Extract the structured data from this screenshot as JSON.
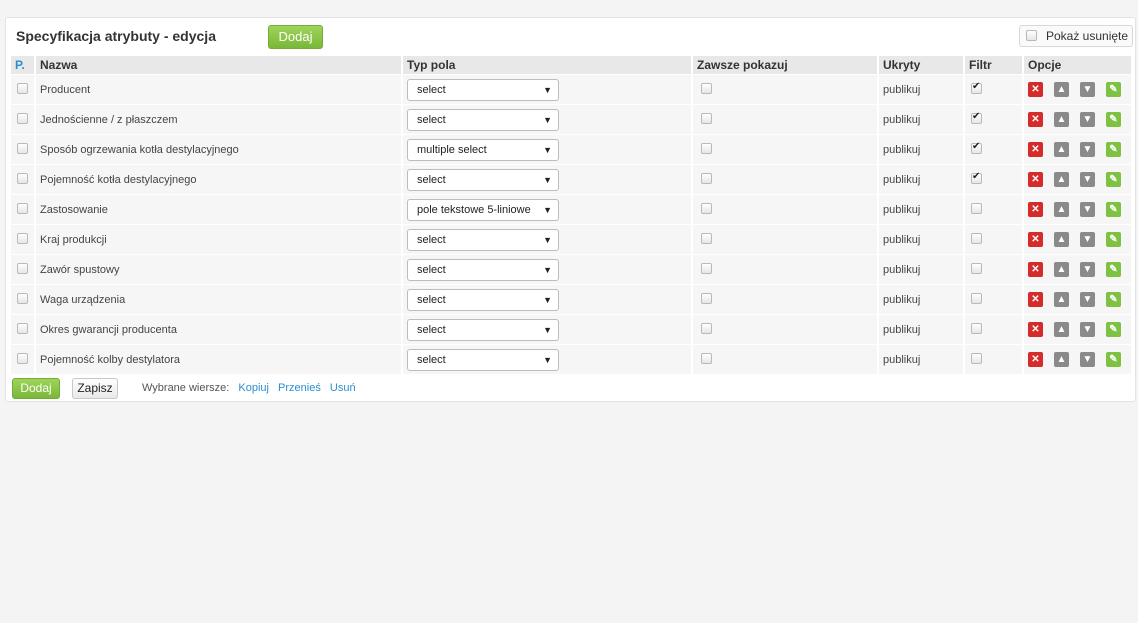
{
  "panel": {
    "title": "Specyfikacja atrybuty - edycja",
    "add_label": "Dodaj",
    "show_deleted_label": "Pokaż usunięte"
  },
  "table": {
    "headers": {
      "p": "P.",
      "name": "Nazwa",
      "type": "Typ pola",
      "always": "Zawsze pokazuj",
      "hidden": "Ukryty",
      "filter": "Filtr",
      "options": "Opcje"
    },
    "rows": [
      {
        "name": "Producent",
        "type": "select",
        "hidden": "publikuj",
        "filter": true
      },
      {
        "name": "Jednościenne / z płaszczem",
        "type": "select",
        "hidden": "publikuj",
        "filter": true
      },
      {
        "name": "Sposób ogrzewania kotła destylacyjnego",
        "type": "multiple select",
        "hidden": "publikuj",
        "filter": true
      },
      {
        "name": "Pojemność kotła destylacyjnego",
        "type": "select",
        "hidden": "publikuj",
        "filter": true
      },
      {
        "name": "Zastosowanie",
        "type": "pole tekstowe 5-liniowe",
        "hidden": "publikuj",
        "filter": false
      },
      {
        "name": "Kraj produkcji",
        "type": "select",
        "hidden": "publikuj",
        "filter": false
      },
      {
        "name": "Zawór spustowy",
        "type": "select",
        "hidden": "publikuj",
        "filter": false
      },
      {
        "name": "Waga urządzenia",
        "type": "select",
        "hidden": "publikuj",
        "filter": false
      },
      {
        "name": "Okres gwarancji producenta",
        "type": "select",
        "hidden": "publikuj",
        "filter": false
      },
      {
        "name": "Pojemność kolby destylatora",
        "type": "select",
        "hidden": "publikuj",
        "filter": false
      }
    ]
  },
  "footer": {
    "add_label": "Dodaj",
    "save_label": "Zapisz",
    "selected_rows_label": "Wybrane wiersze:",
    "copy_label": "Kopiuj",
    "move_label": "Przenieś",
    "delete_label": "Usuń"
  },
  "icons": {
    "delete": "close-icon",
    "up": "arrow-up-icon",
    "down": "arrow-down-icon",
    "edit": "edit-icon"
  },
  "colors": {
    "accent_green": "#7ab738",
    "link_blue": "#2a8fcf",
    "delete_red": "#d62b2b"
  }
}
